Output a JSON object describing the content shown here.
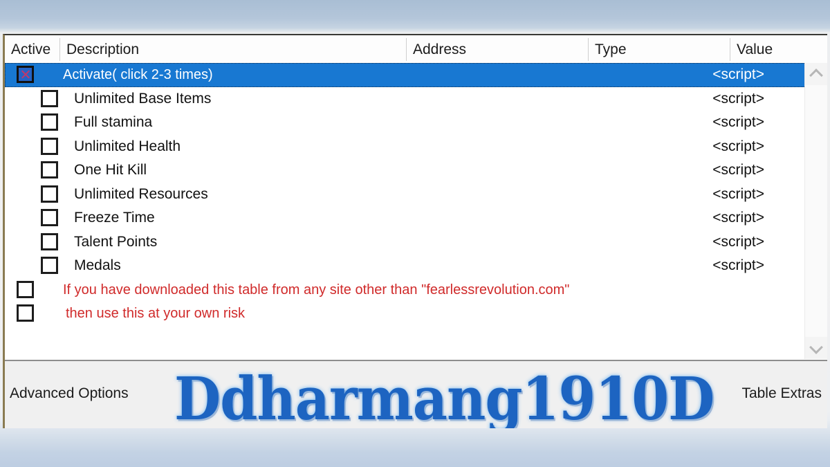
{
  "window": {
    "columns": [
      {
        "key": "active",
        "label": "Active"
      },
      {
        "key": "description",
        "label": "Description"
      },
      {
        "key": "address",
        "label": "Address"
      },
      {
        "key": "type",
        "label": "Type"
      },
      {
        "key": "value",
        "label": "Value"
      }
    ]
  },
  "rows": [
    {
      "description": "Activate( click 2-3 times)",
      "address": "",
      "type": "",
      "value": "<script>",
      "checked": true,
      "selected": true,
      "indent": "parent",
      "color": "white"
    },
    {
      "description": "Unlimited Base Items",
      "address": "",
      "type": "",
      "value": "<script>",
      "checked": false,
      "selected": false,
      "indent": "child",
      "color": "black"
    },
    {
      "description": "Full stamina",
      "address": "",
      "type": "",
      "value": "<script>",
      "checked": false,
      "selected": false,
      "indent": "child",
      "color": "black"
    },
    {
      "description": "Unlimited Health",
      "address": "",
      "type": "",
      "value": "<script>",
      "checked": false,
      "selected": false,
      "indent": "child",
      "color": "black"
    },
    {
      "description": "One Hit Kill",
      "address": "",
      "type": "",
      "value": "<script>",
      "checked": false,
      "selected": false,
      "indent": "child",
      "color": "black"
    },
    {
      "description": "Unlimited Resources",
      "address": "",
      "type": "",
      "value": "<script>",
      "checked": false,
      "selected": false,
      "indent": "child",
      "color": "black"
    },
    {
      "description": "Freeze Time",
      "address": "",
      "type": "",
      "value": "<script>",
      "checked": false,
      "selected": false,
      "indent": "child",
      "color": "black"
    },
    {
      "description": "Talent Points",
      "address": "",
      "type": "",
      "value": "<script>",
      "checked": false,
      "selected": false,
      "indent": "child",
      "color": "black"
    },
    {
      "description": "Medals",
      "address": "",
      "type": "",
      "value": "<script>",
      "checked": false,
      "selected": false,
      "indent": "child",
      "color": "black"
    },
    {
      "description": "If you have downloaded this table from any site other than \"fearlessrevolution.com\"",
      "address": "",
      "type": "",
      "value": "",
      "checked": false,
      "selected": false,
      "indent": "parent",
      "color": "red"
    },
    {
      "description": "then use this at your own risk",
      "address": "",
      "type": "",
      "value": "",
      "checked": false,
      "selected": false,
      "indent": "parent",
      "color": "red"
    }
  ],
  "scrollbar": {
    "up_arrow": "chevron-up-icon",
    "down_arrow": "chevron-down-icon"
  },
  "bottom_bar": {
    "advanced_options": "Advanced Options",
    "table_extras": "Table Extras",
    "watermark": "Ddharmang1910D"
  },
  "colors": {
    "selection_blue": "#1878d2",
    "warning_red": "#d02a2a",
    "watermark_blue": "#1760c0",
    "header_text": "#1b1b1b",
    "window_bg": "#ffffff"
  }
}
